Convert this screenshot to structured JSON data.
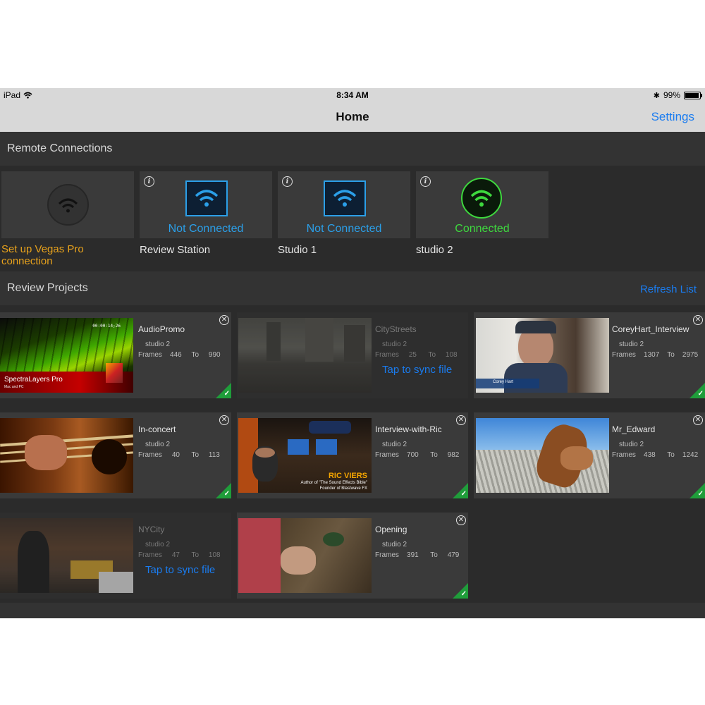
{
  "status_bar": {
    "device": "iPad",
    "time": "8:34 AM",
    "battery": "99%"
  },
  "nav": {
    "title": "Home",
    "settings_label": "Settings"
  },
  "remote_connections": {
    "header": "Remote Connections",
    "items": [
      {
        "name": "Set up Vegas Pro connection",
        "state": "",
        "kind": "setup"
      },
      {
        "name": "Review Station",
        "state": "Not Connected",
        "kind": "not_connected"
      },
      {
        "name": "Studio 1",
        "state": "Not Connected",
        "kind": "not_connected"
      },
      {
        "name": "studio 2",
        "state": "Connected",
        "kind": "connected"
      }
    ]
  },
  "review_projects": {
    "header": "Review Projects",
    "refresh_label": "Refresh List",
    "frames_label": "Frames",
    "to_label": "To",
    "sync_label": "Tap to sync file",
    "items": [
      {
        "name": "AudioPromo",
        "server": "studio 2",
        "from": "446",
        "to": "990",
        "synced": true,
        "thumb_text": "SpectraLayers Pro",
        "thumb_sub": "Mac and PC",
        "timecode": "00:00:14;26"
      },
      {
        "name": "CityStreets",
        "server": "studio 2",
        "from": "25",
        "to": "108",
        "synced": false
      },
      {
        "name": "CoreyHart_Interview",
        "server": "studio 2",
        "from": "1307",
        "to": "2975",
        "synced": true,
        "thumb_text": "Corey Hart"
      },
      {
        "name": "In-concert",
        "server": "studio 2",
        "from": "40",
        "to": "113",
        "synced": true
      },
      {
        "name": "Interview-with-Ric",
        "server": "studio 2",
        "from": "700",
        "to": "982",
        "synced": true,
        "thumb_text": "RIC VIERS",
        "thumb_sub": "Author of \"The Sound Effects Bible\"",
        "thumb_sub2": "Founder of Blastwave FX"
      },
      {
        "name": "Mr_Edward",
        "server": "studio 2",
        "from": "438",
        "to": "1242",
        "synced": true
      },
      {
        "name": "NYCity",
        "server": "studio 2",
        "from": "47",
        "to": "108",
        "synced": false
      },
      {
        "name": "Opening",
        "server": "studio 2",
        "from": "391",
        "to": "479",
        "synced": true
      }
    ]
  },
  "colors": {
    "accent": "#1a7cf0",
    "connected": "#3ed93e",
    "not_connected": "#2b9fe8",
    "setup": "#e8a21c",
    "synced_badge": "#1f9d3a"
  }
}
